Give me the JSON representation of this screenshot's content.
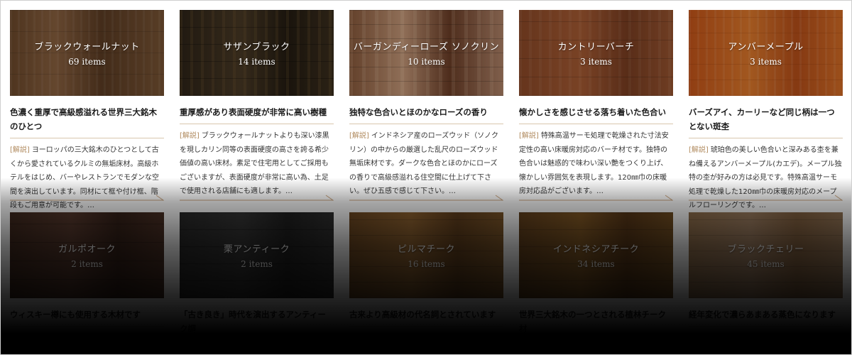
{
  "tag_label": "[解説]",
  "items": [
    {
      "name": "ブラックウォールナット",
      "count": "69 items",
      "headline": "色濃く重厚で高級感溢れる世界三大銘木のひとつ",
      "desc": "ヨーロッパの三大銘木のひとつとして古くから愛されているクルミの無垢床材。高級ホテルをはじめ、バーやレストランでモダンな空間を演出しています。同材にて框や付け框、階段もご用意が可能です。…"
    },
    {
      "name": "サザンブラック",
      "count": "14 items",
      "headline": "重厚感があり表面硬度が非常に高い樹種",
      "desc": "ブラックウォールナットよりも深い漆黒を現しカリン同等の表面硬度の高さを誇る希少価値の高い床材。素足で住宅用としてご採用もございますが、表面硬度が非常に高い為、土足で使用される店舗にも適します。…"
    },
    {
      "name": "バーガンディーローズ ソノクリン",
      "count": "10 items",
      "headline": "独特な色合いとほのかなローズの香り",
      "desc": "インドネシア産のローズウッド（ソノクリン）の中からの厳選した乱尺のローズウッド無垢床材です。ダークな色合とほのかにローズの香りで高級感溢れる住空間に仕上げて下さい。ぜひ五感で感じて下さい。…"
    },
    {
      "name": "カントリーバーチ",
      "count": "3 items",
      "headline": "懐かしさを感じさせる落ち着いた色合い",
      "desc": "特殊高温サーモ処理で乾燥された寸法安定性の高い床暖房対応のバーチ材です。独特の色合いは魅惑的で味わい深い艶をつくり上げ、懐かしい雰囲気を表現します。120㎜巾の床暖房対応品がございます。…"
    },
    {
      "name": "アンバーメープル",
      "count": "3 items",
      "headline": "バーズアイ、カーリーなど同じ柄は一つとない斑杢",
      "desc": "琥珀色の美しい色合いと深みある杢を兼ね備えるアンバーメープル(カエデ)。メープル独特の杢が好みの方は必見です。特殊高温サーモ処理で乾燥した120㎜巾の床暖房対応のメープルフローリングです。…"
    },
    {
      "name": "ガルポオーク",
      "count": "2 items",
      "headline": "ウィスキー樽にも使用する木材です",
      "desc": ""
    },
    {
      "name": "栗アンティーク",
      "count": "2 items",
      "headline": "「古き良き」時代を演出するアンティーク調",
      "desc": ""
    },
    {
      "name": "ピルマチーク",
      "count": "16 items",
      "headline": "古来より高級材の代名詞とされています",
      "desc": ""
    },
    {
      "name": "インドネシアチーク",
      "count": "34 items",
      "headline": "世界三大銘木の一つとされる植林チーク材",
      "desc": ""
    },
    {
      "name": "ブラックチェリー",
      "count": "45 items",
      "headline": "経年変化で濃らあまある蒸色になります",
      "desc": ""
    }
  ]
}
